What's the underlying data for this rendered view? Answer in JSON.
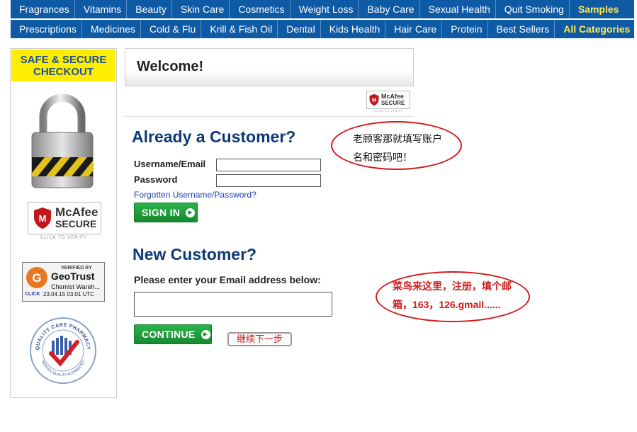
{
  "nav_row1": [
    "Fragrances",
    "Vitamins",
    "Beauty",
    "Skin Care",
    "Cosmetics",
    "Weight Loss",
    "Baby Care",
    "Sexual Health",
    "Quit Smoking",
    "Samples"
  ],
  "nav_row2": [
    "Prescriptions",
    "Medicines",
    "Cold & Flu",
    "Krill & Fish Oil",
    "Dental",
    "Kids Health",
    "Hair Care",
    "Protein",
    "Best Sellers",
    "All Categories"
  ],
  "sidebar": {
    "safe_title": "SAFE & SECURE CHECKOUT",
    "mcafee": {
      "line1": "McAfee",
      "line2": "SECURE",
      "verify": "CLICK TO VERIFY"
    },
    "geotrust": {
      "verified": "VERIFIED BY",
      "brand": "GeoTrust",
      "company": "Chemist Wareh...",
      "click": "CLICK",
      "date": "23.04.15 03:01 UTC"
    },
    "qcp": {
      "ring_top": "QUALITY CARE PHARMACY",
      "ring_bottom": "SERVICE QUALITY ACCREDITED"
    }
  },
  "welcome_title": "Welcome!",
  "mcafee_small": {
    "line1": "McAfee",
    "line2": "SECURE",
    "verify": "CLICK TO VERIFY"
  },
  "existing": {
    "heading": "Already a Customer?",
    "username_label": "Username/Email",
    "password_label": "Password",
    "username_value": "",
    "password_value": "",
    "forgot_link": "Forgotten Username/Password?",
    "signin_label": "SIGN IN"
  },
  "new_customer": {
    "heading": "New Customer?",
    "email_label": "Please enter your Email address below:",
    "email_value": "",
    "continue_label": "CONTINUE"
  },
  "annotations": {
    "bubble1_line1": "老顾客那就填写账户",
    "bubble1_line2": "名和密码吧！",
    "bubble2_line1": "菜鸟来这里，注册，填个邮",
    "bubble2_line2": "箱，163，126.gmail......",
    "next_step": "继续下一步"
  },
  "colors": {
    "nav_bg": "#0f5aa5",
    "nav_highlight": "#ffe94f",
    "safe_box": "#ffed00",
    "heading": "#0e3a74",
    "button_green": "#1f9e3b",
    "annotation_red": "#d11a1a"
  }
}
